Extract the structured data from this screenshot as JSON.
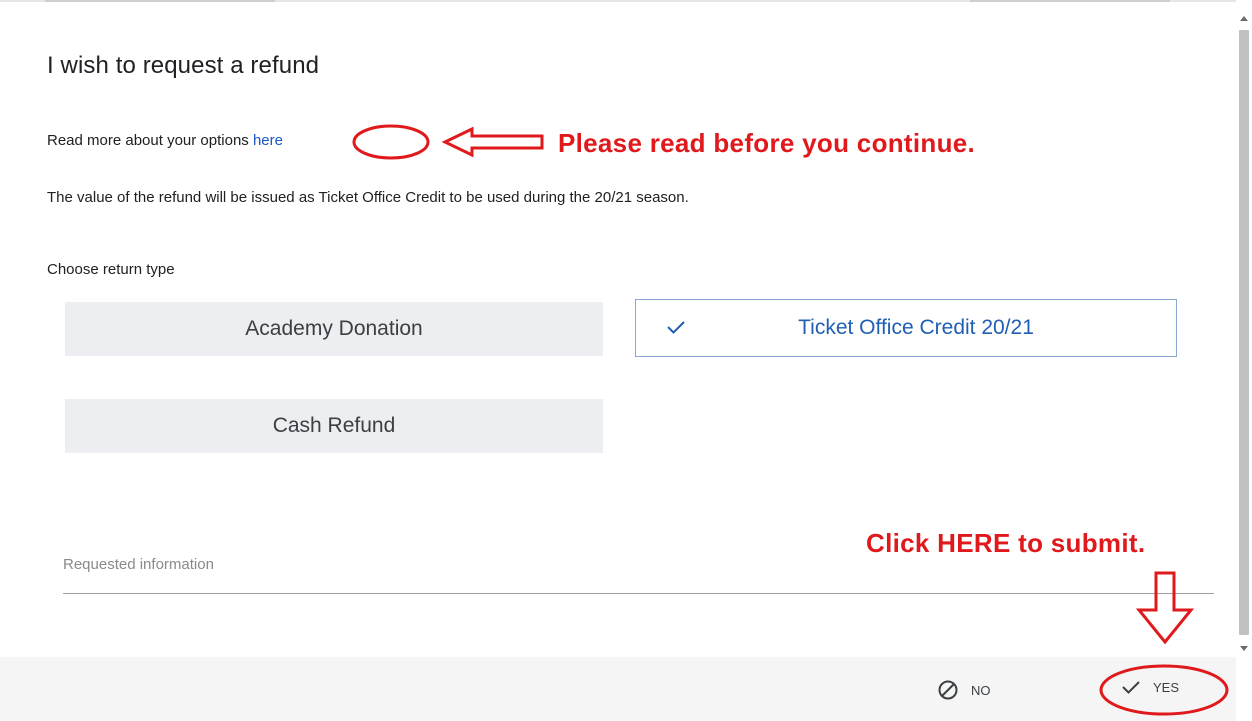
{
  "dialog": {
    "title": "I wish to request a refund",
    "read_more_text": "Read more about your options",
    "read_more_link": "here",
    "notice": "The value of the refund will be issued as Ticket Office Credit to be used during the 20/21 season.",
    "choose_label": "Choose return type",
    "options": [
      {
        "label": "Academy Donation",
        "selected": false
      },
      {
        "label": "Ticket Office Credit 20/21",
        "selected": true
      },
      {
        "label": "Cash Refund",
        "selected": false
      }
    ],
    "requested_info_placeholder": "Requested information"
  },
  "footer": {
    "no_label": "NO",
    "yes_label": "YES"
  },
  "annotations": {
    "read_callout": "Please read before you continue.",
    "submit_callout": "Click HERE to submit.",
    "color": "#e0191c"
  },
  "colors": {
    "link": "#1a57c8",
    "selected_text": "#1f5fb5",
    "selected_border": "#8aa9d6",
    "option_bg": "#eceef1",
    "footer_bg": "#f5f5f5"
  }
}
